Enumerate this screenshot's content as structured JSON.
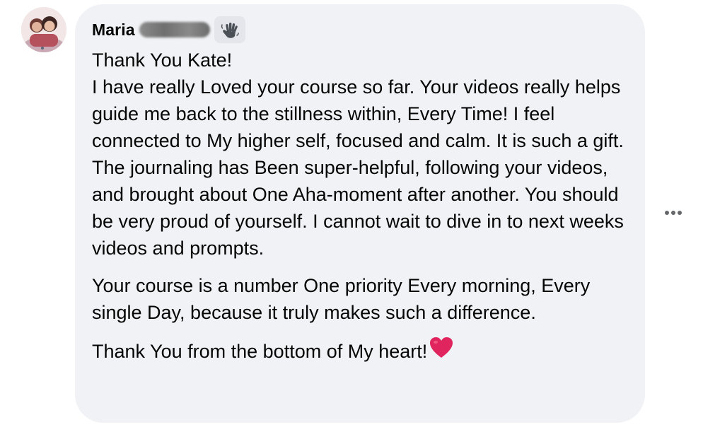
{
  "comment": {
    "author_name": "Maria",
    "paragraphs": [
      "Thank You Kate!\nI have really Loved your course so far. Your videos really helps guide me back to the stillness within, Every Time! I feel connected to My higher self, focused and calm. It is such a gift. The journaling has Been super-helpful, following your videos, and brought about One Aha-moment after another. You should be very proud of yourself. I cannot wait to dive in to next weeks videos and prompts.",
      "Your course is a number One priority Every morning, Every single Day, because it truly makes such a difference.",
      "Thank You from the bottom of My heart!"
    ]
  },
  "icons": {
    "badge": "wave-hand-icon",
    "trailing_emoji": "red-heart-icon",
    "more": "more-options-icon"
  },
  "colors": {
    "bubble_background": "#f0f2f5",
    "text": "#050505",
    "heart": "#e0245e",
    "more_dots": "#65676b"
  }
}
